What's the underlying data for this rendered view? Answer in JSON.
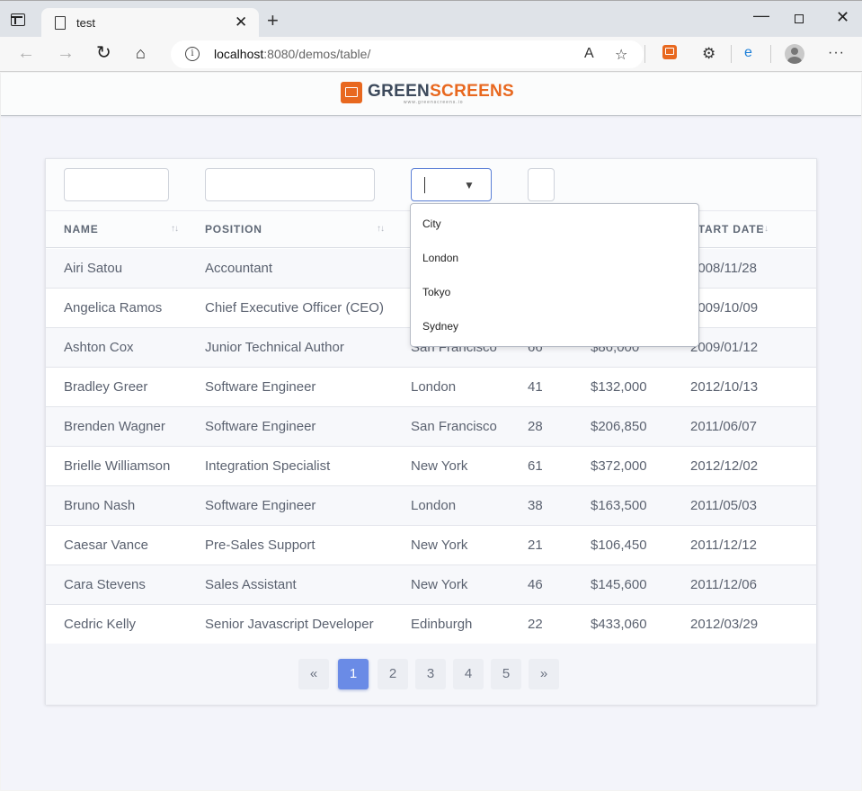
{
  "browser": {
    "tab_title": "test",
    "url_host": "localhost",
    "url_rest": ":8080/demos/table/"
  },
  "header": {
    "logo_green": "GREEN",
    "logo_screens": "SCREENS",
    "logo_sub": "www.greenscreens.io"
  },
  "table": {
    "columns": [
      "NAME",
      "POSITION",
      "",
      "",
      "",
      "START DATE"
    ],
    "rows": [
      [
        "Airi Satou",
        "Accountant",
        "",
        "",
        "",
        "2008/11/28"
      ],
      [
        "Angelica Ramos",
        "Chief Executive Officer (CEO)",
        "",
        "",
        "",
        "2009/10/09"
      ],
      [
        "Ashton Cox",
        "Junior Technical Author",
        "San Francisco",
        "66",
        "$86,000",
        "2009/01/12"
      ],
      [
        "Bradley Greer",
        "Software Engineer",
        "London",
        "41",
        "$132,000",
        "2012/10/13"
      ],
      [
        "Brenden Wagner",
        "Software Engineer",
        "San Francisco",
        "28",
        "$206,850",
        "2011/06/07"
      ],
      [
        "Brielle Williamson",
        "Integration Specialist",
        "New York",
        "61",
        "$372,000",
        "2012/12/02"
      ],
      [
        "Bruno Nash",
        "Software Engineer",
        "London",
        "38",
        "$163,500",
        "2011/05/03"
      ],
      [
        "Caesar Vance",
        "Pre-Sales Support",
        "New York",
        "21",
        "$106,450",
        "2011/12/12"
      ],
      [
        "Cara Stevens",
        "Sales Assistant",
        "New York",
        "46",
        "$145,600",
        "2011/12/06"
      ],
      [
        "Cedric Kelly",
        "Senior Javascript Developer",
        "Edinburgh",
        "22",
        "$433,060",
        "2012/03/29"
      ]
    ]
  },
  "dropdown": {
    "options": [
      "City",
      "London",
      "Tokyo",
      "Sydney"
    ]
  },
  "pagination": {
    "prev": "«",
    "pages": [
      "1",
      "2",
      "3",
      "4",
      "5"
    ],
    "next": "»",
    "active": "1"
  },
  "colors": {
    "accent": "#6a8be6",
    "brand_orange": "#e8681f",
    "brand_dark": "#3d4a5c"
  }
}
